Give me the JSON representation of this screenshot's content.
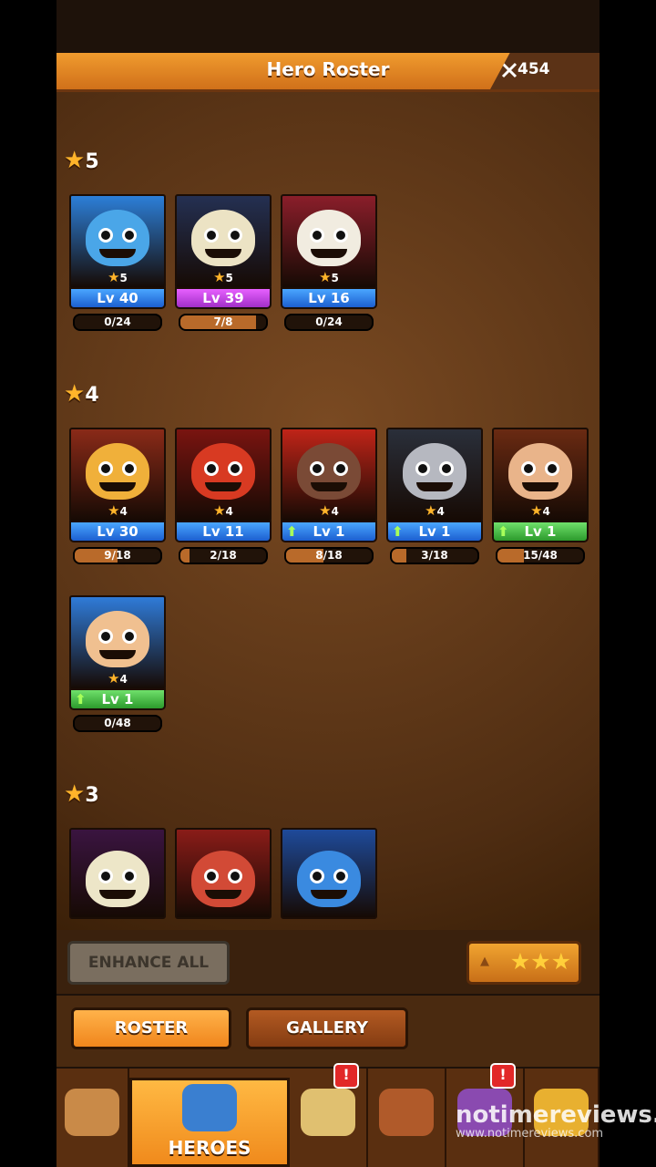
{
  "header": {
    "title": "Hero Roster",
    "power_icon": "crossed-swords-icon",
    "power": "454"
  },
  "tiers": [
    {
      "stars": "5",
      "heroes": [
        {
          "name": "hero-1",
          "stars": "5",
          "level": "Lv 40",
          "level_style": "blue",
          "upgrade": false,
          "progress": "0/24",
          "fill": 0.0,
          "bg": "#2c7fd8",
          "face": "#4aa6e8"
        },
        {
          "name": "hero-2",
          "stars": "5",
          "level": "Lv 39",
          "level_style": "purple",
          "upgrade": false,
          "progress": "7/8",
          "fill": 0.875,
          "bg": "#243052",
          "face": "#ece3c4"
        },
        {
          "name": "hero-3",
          "stars": "5",
          "level": "Lv 16",
          "level_style": "blue",
          "upgrade": false,
          "progress": "0/24",
          "fill": 0.0,
          "bg": "#8a1e2a",
          "face": "#f1ece0"
        }
      ]
    },
    {
      "stars": "4",
      "heroes": [
        {
          "name": "hero-4",
          "stars": "4",
          "level": "Lv 30",
          "level_style": "blue",
          "upgrade": false,
          "progress": "9/18",
          "fill": 0.5,
          "bg": "#8a2a18",
          "face": "#f0b03a"
        },
        {
          "name": "hero-5",
          "stars": "4",
          "level": "Lv 11",
          "level_style": "blue",
          "upgrade": false,
          "progress": "2/18",
          "fill": 0.11,
          "bg": "#7a1410",
          "face": "#d83a22"
        },
        {
          "name": "hero-6",
          "stars": "4",
          "level": "Lv 1",
          "level_style": "blue",
          "upgrade": true,
          "progress": "8/18",
          "fill": 0.44,
          "bg": "#c02418",
          "face": "#7a4a36"
        },
        {
          "name": "hero-7",
          "stars": "4",
          "level": "Lv 1",
          "level_style": "blue",
          "upgrade": true,
          "progress": "3/18",
          "fill": 0.17,
          "bg": "#2a2f3a",
          "face": "#b6b8c0"
        },
        {
          "name": "hero-8",
          "stars": "4",
          "level": "Lv 1",
          "level_style": "green",
          "upgrade": true,
          "progress": "15/48",
          "fill": 0.31,
          "bg": "#6a2a12",
          "face": "#e9b48a"
        },
        {
          "name": "hero-9",
          "stars": "4",
          "level": "Lv 1",
          "level_style": "green",
          "upgrade": true,
          "progress": "0/48",
          "fill": 0.0,
          "bg": "#2f7bd8",
          "face": "#f0c090"
        }
      ]
    },
    {
      "stars": "3",
      "heroes": [
        {
          "name": "hero-10",
          "bg": "#3a1440",
          "face": "#ede6c8"
        },
        {
          "name": "hero-11",
          "bg": "#8a1c18",
          "face": "#d24a36"
        },
        {
          "name": "hero-12",
          "bg": "#1e4a9a",
          "face": "#3a8ae0"
        }
      ]
    }
  ],
  "actions": {
    "enhance_all": "ENHANCE ALL",
    "filter_stars": "★★★",
    "filter_arrow": "▲"
  },
  "subtabs": {
    "roster": "ROSTER",
    "gallery": "GALLERY"
  },
  "nav": {
    "items": [
      {
        "name": "nav-map",
        "icon": "map-icon",
        "label": "",
        "active": false,
        "badge": ""
      },
      {
        "name": "nav-heroes",
        "icon": "pirate-hat-icon",
        "label": "HEROES",
        "active": true,
        "badge": ""
      },
      {
        "name": "nav-battle",
        "icon": "crossed-swords-icon",
        "label": "",
        "active": false,
        "badge": "!"
      },
      {
        "name": "nav-ship",
        "icon": "ship-icon",
        "label": "",
        "active": false,
        "badge": ""
      },
      {
        "name": "nav-shop",
        "icon": "potion-icon",
        "label": "",
        "active": false,
        "badge": "!"
      },
      {
        "name": "nav-treasure",
        "icon": "treasure-chest-icon",
        "label": "",
        "active": false,
        "badge": ""
      }
    ]
  },
  "watermark": {
    "brand": "notimereviews.",
    "url": "www.notimereviews.com"
  },
  "colors": {
    "accent": "#f0861c",
    "panel": "#4f2d12",
    "level_blue": "#1c5fd0",
    "level_green": "#2c9a2c",
    "level_purple": "#a12fc7"
  }
}
